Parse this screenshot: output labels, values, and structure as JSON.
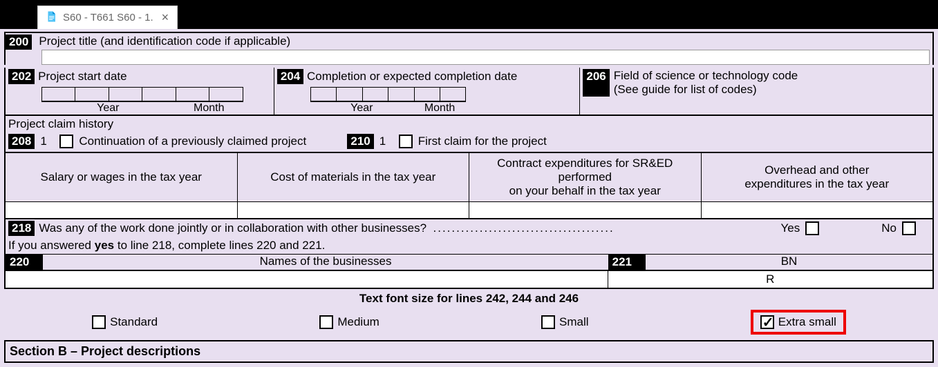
{
  "tab": {
    "title": "S60 - T661 S60 - 1."
  },
  "line200": {
    "num": "200",
    "label": "Project title (and identification code if applicable)"
  },
  "line202": {
    "num": "202",
    "label": "Project start date",
    "year": "Year",
    "month": "Month"
  },
  "line204": {
    "num": "204",
    "label": "Completion or expected completion date",
    "year": "Year",
    "month": "Month"
  },
  "line206": {
    "num": "206",
    "label": "Field of science or technology code",
    "sub": "(See guide for list of codes)"
  },
  "history": {
    "label": "Project claim history"
  },
  "line208": {
    "num": "208",
    "val": "1",
    "label": "Continuation of a previously claimed project"
  },
  "line210": {
    "num": "210",
    "val": "1",
    "label": "First claim for the project"
  },
  "grid": {
    "c1": "Salary or wages in the tax year",
    "c2": "Cost of materials in the tax year",
    "c3a": "Contract expenditures for SR&ED",
    "c3b": "performed",
    "c3c": "on your behalf in the tax year",
    "c4a": "Overhead and other",
    "c4b": "expenditures in the tax year"
  },
  "line218": {
    "num": "218",
    "q": "Was any of the work done jointly or in collaboration with other businesses?",
    "yes": "Yes",
    "no": "No"
  },
  "yesline": {
    "pre": "If you answered ",
    "bold": "yes",
    "post": " to line 218, complete lines 220 and 221."
  },
  "line220": {
    "num": "220",
    "label": "Names of the businesses"
  },
  "line221": {
    "num": "221",
    "label": "BN",
    "val": "R"
  },
  "fonthdr": "Text font size for lines 242, 244 and 246",
  "fontopts": {
    "standard": "Standard",
    "medium": "Medium",
    "small": "Small",
    "xsmall": "Extra small"
  },
  "sectionB": "Section B – Project descriptions"
}
